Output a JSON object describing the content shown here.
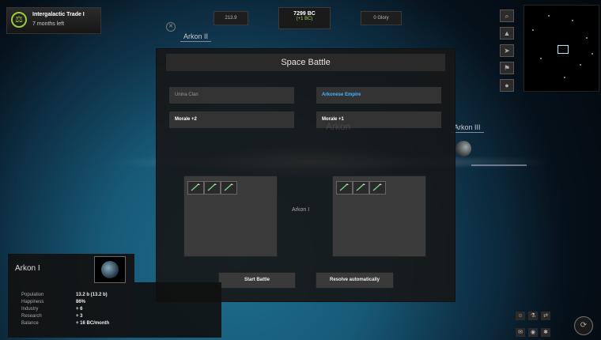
{
  "quest": {
    "title": "Intergalactic Trade I",
    "subtitle": "7 months left"
  },
  "resources": {
    "left_value": "213.9",
    "bc_main": "7299 BC",
    "bc_sub": "(+1 BC)",
    "glory": "0 Glory"
  },
  "map_labels": {
    "arkon2": "Arkon II",
    "arkon3": "Arkon III",
    "arkon_ghost": "Arkon",
    "center_planet": "Arkon I"
  },
  "dialog": {
    "title": "Space Battle",
    "left_faction": "Unina Clan",
    "right_faction": "Arkonese Empire",
    "left_morale": "Morale +2",
    "right_morale": "Morale +1",
    "start_button": "Start Battle",
    "resolve_button": "Resolve automatically"
  },
  "planet_panel": {
    "name": "Arkon I",
    "stats": [
      {
        "label": "Population",
        "value": "13.2 b (13.2 b)"
      },
      {
        "label": "Happiness",
        "value": "86%"
      },
      {
        "label": "Industry",
        "value": "+ 6"
      },
      {
        "label": "Research",
        "value": "+ 3"
      },
      {
        "label": "Balance",
        "value": "+ 16 BC/month"
      }
    ]
  },
  "colors": {
    "faction_right": "#3fb7ff",
    "growth_green": "#9ecf5a",
    "ship_green": "#6fcf8a"
  },
  "icons": {
    "right_toolbar": [
      "search-icon",
      "research-icon",
      "ship-icon",
      "colony-icon",
      "planet-icon"
    ],
    "bottom_right": [
      "leader-icon",
      "lab-icon",
      "trade-icon",
      "mail-icon",
      "eye-icon",
      "alert-icon"
    ]
  }
}
